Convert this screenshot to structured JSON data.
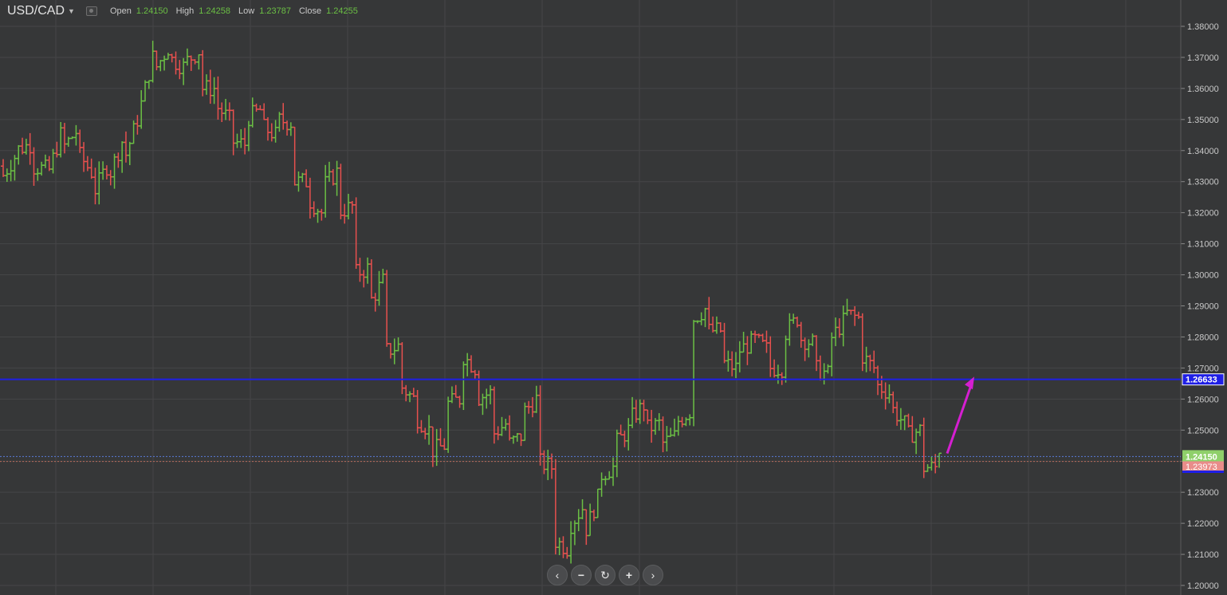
{
  "header": {
    "symbol": "USD/CAD",
    "open_label": "Open",
    "open_value": "1.24150",
    "high_label": "High",
    "high_value": "1.24258",
    "low_label": "Low",
    "low_value": "1.23787",
    "close_label": "Close",
    "close_value": "1.24255"
  },
  "icons": {
    "dropdown": "chevron-down-icon",
    "visibility": "eye-icon",
    "nav": [
      "chevron-left-icon",
      "zoom-out-icon",
      "reset-icon",
      "zoom-in-icon",
      "chevron-right-icon"
    ]
  },
  "nav": {
    "left": "‹",
    "zoom_out": "−",
    "reset": "↻",
    "zoom_in": "+",
    "right": "›"
  },
  "colors": {
    "background": "#363738",
    "grid": "#454647",
    "up": "#6bbf44",
    "down": "#e7504e",
    "hline": "#1f1fe6",
    "arrow": "#d51fd1"
  },
  "chart_data": {
    "type": "ohlc",
    "title": "USD/CAD",
    "ylim": [
      1.2,
      1.385
    ],
    "y_ticks": [
      "1.38000",
      "1.37000",
      "1.36000",
      "1.35000",
      "1.34000",
      "1.33000",
      "1.32000",
      "1.31000",
      "1.30000",
      "1.29000",
      "1.28000",
      "1.27000",
      "1.26000",
      "1.25000",
      "1.24000",
      "1.23000",
      "1.22000",
      "1.21000",
      "1.20000"
    ],
    "grid": true,
    "horizontal_lines": [
      {
        "value": 1.26633,
        "label": "1.26633",
        "style": "solid"
      },
      {
        "value": 1.2415,
        "label": "1.24150",
        "style": "dotted"
      },
      {
        "value": 1.2399,
        "label": "",
        "style": "dotted"
      }
    ],
    "price_labels": [
      {
        "value": 1.2415,
        "text": "1.24150",
        "color": "#8fd06a"
      },
      {
        "value": 1.2398,
        "text": "1.23973",
        "color": "#e98c8a"
      }
    ],
    "annotation_arrow": {
      "from": 1.2425,
      "to": 1.2672,
      "direction": "up"
    },
    "anchors": [
      [
        1.335,
        1.33
      ],
      [
        1.338,
        1.34
      ],
      [
        1.342,
        1.335
      ],
      [
        1.334,
        1.33
      ],
      [
        1.345,
        1.34
      ],
      [
        1.346,
        1.34
      ],
      [
        1.333,
        1.325
      ],
      [
        1.335,
        1.33
      ],
      [
        1.343,
        1.335
      ],
      [
        1.35,
        1.35
      ],
      [
        1.37,
        1.365
      ],
      [
        1.373,
        1.37
      ],
      [
        1.367,
        1.368
      ],
      [
        1.372,
        1.36
      ],
      [
        1.36,
        1.355
      ],
      [
        1.35,
        1.343
      ],
      [
        1.342,
        1.35
      ],
      [
        1.353,
        1.348
      ],
      [
        1.345,
        1.35
      ],
      [
        1.349,
        1.33
      ],
      [
        1.33,
        1.325
      ],
      [
        1.32,
        1.328
      ],
      [
        1.333,
        1.32
      ],
      [
        1.322,
        1.3
      ],
      [
        1.302,
        1.29
      ],
      [
        1.298,
        1.275
      ],
      [
        1.277,
        1.265
      ],
      [
        1.26,
        1.255
      ],
      [
        1.25,
        1.243
      ],
      [
        1.245,
        1.258
      ],
      [
        1.26,
        1.275
      ],
      [
        1.27,
        1.26
      ],
      [
        1.262,
        1.248
      ],
      [
        1.252,
        1.245
      ],
      [
        1.248,
        1.255
      ],
      [
        1.26,
        1.24
      ],
      [
        1.238,
        1.215
      ],
      [
        1.212,
        1.218
      ],
      [
        1.225,
        1.215
      ],
      [
        1.228,
        1.235
      ],
      [
        1.238,
        1.245
      ],
      [
        1.25,
        1.253
      ],
      [
        1.258,
        1.25
      ],
      [
        1.252,
        1.245
      ],
      [
        1.248,
        1.252
      ],
      [
        1.256,
        1.285
      ],
      [
        1.289,
        1.282
      ],
      [
        1.282,
        1.272
      ],
      [
        1.27,
        1.275
      ],
      [
        1.278,
        1.28
      ],
      [
        1.276,
        1.27
      ],
      [
        1.27,
        1.28
      ],
      [
        1.286,
        1.28
      ],
      [
        1.278,
        1.27
      ],
      [
        1.268,
        1.278
      ],
      [
        1.285,
        1.288
      ],
      [
        1.286,
        1.275
      ],
      [
        1.27,
        1.265
      ],
      [
        1.262,
        1.258
      ],
      [
        1.252,
        1.248
      ],
      [
        1.25,
        1.238
      ],
      [
        1.238,
        1.2425
      ]
    ]
  }
}
